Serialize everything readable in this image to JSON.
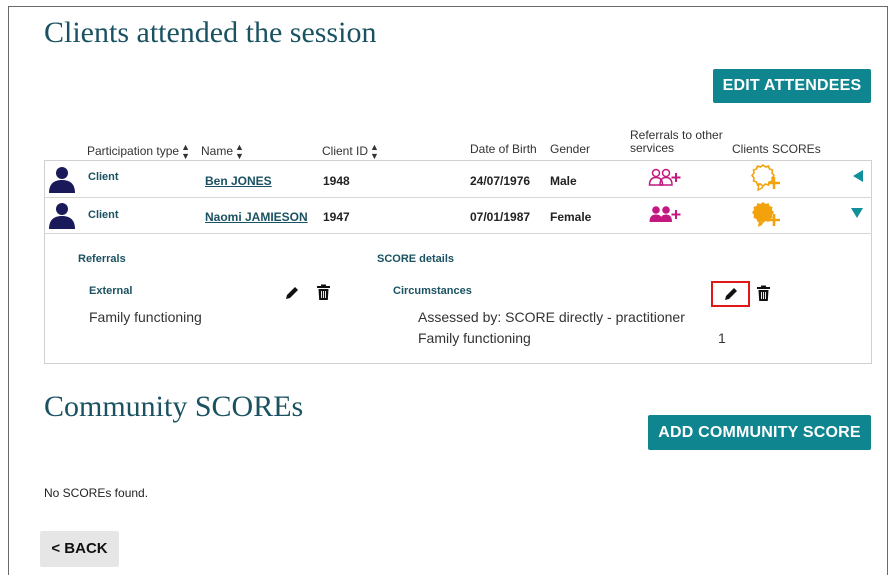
{
  "page": {
    "title": "Clients attended the session"
  },
  "toolbar": {
    "edit_attendees_label": "EDIT ATTENDEES"
  },
  "table": {
    "headers": {
      "participation_type": "Participation type",
      "name": "Name",
      "client_id": "Client ID",
      "dob": "Date of Birth",
      "gender": "Gender",
      "referrals_line1": "Referrals to other",
      "referrals_line2": "services",
      "scores": "Clients SCOREs"
    },
    "rows": [
      {
        "participation": "Client",
        "name": "Ben JONES",
        "client_id": "1948",
        "dob": "24/07/1976",
        "gender": "Male",
        "expanded": false
      },
      {
        "participation": "Client",
        "name": "Naomi JAMIESON",
        "client_id": "1947",
        "dob": "07/01/1987",
        "gender": "Female",
        "expanded": true
      }
    ]
  },
  "details": {
    "referrals_heading": "Referrals",
    "referral_type": "External",
    "referral_value": "Family functioning",
    "score_heading": "SCORE details",
    "score_type": "Circumstances",
    "assessed_by": "Assessed by: SCORE directly - practitioner",
    "score_domain": "Family functioning",
    "score_value": "1"
  },
  "community": {
    "title": "Community SCOREs",
    "add_label": "ADD COMMUNITY SCORE",
    "empty_message": "No SCOREs found."
  },
  "nav": {
    "back_label": "< BACK"
  },
  "colors": {
    "teal": "#0f8590",
    "heading": "#1a5261",
    "magenta": "#c2187f",
    "gold": "#f2a20c",
    "highlight": "#e01818"
  },
  "icons": {
    "person": "person-icon",
    "referral": "referral-people-add-icon",
    "score": "award-badge-add-icon",
    "edit": "pencil-icon",
    "delete": "trash-icon",
    "collapse": "triangle-left-icon",
    "expand": "triangle-down-icon",
    "sort": "sort-arrows-icon"
  }
}
